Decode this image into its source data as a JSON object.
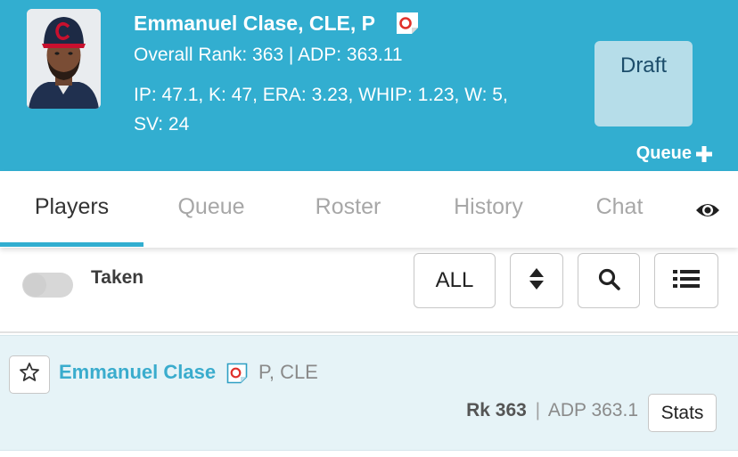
{
  "player": {
    "name_line": "Emmanuel Clase, CLE, P",
    "rank_line": "Overall Rank: 363 | ADP: 363.11",
    "stats_line1": "IP: 47.1, K: 47, ERA: 3.23, WHIP: 1.23, W: 5,",
    "stats_line2": "SV: 24",
    "photo_icon": "player-headshot-icon",
    "news_icon": "news-note-icon"
  },
  "actions": {
    "draft_label": "Draft",
    "queue_label": "Queue"
  },
  "tabs": [
    {
      "label": "Players",
      "active": true
    },
    {
      "label": "Queue",
      "active": false
    },
    {
      "label": "Roster",
      "active": false
    },
    {
      "label": "History",
      "active": false
    },
    {
      "label": "Chat",
      "active": false
    }
  ],
  "filters": {
    "taken_label": "Taken",
    "taken_on": false,
    "position_filter": "ALL",
    "sort_icon": "sort-updown-icon",
    "search_icon": "search-icon",
    "list_icon": "list-view-icon"
  },
  "rows": [
    {
      "name": "Emmanuel Clase",
      "position_team": "P, CLE",
      "rank_label": "Rk 363",
      "separator": "|",
      "adp_label": "ADP 363.1",
      "stats_button": "Stats",
      "starred": false
    }
  ],
  "colors": {
    "header_bg": "#32aed0",
    "draft_button_bg": "#b6dde9",
    "accent": "#32aed0",
    "row_bg": "#e6f3f7",
    "player_link": "#3aaccd",
    "news_red": "#e0302a"
  }
}
